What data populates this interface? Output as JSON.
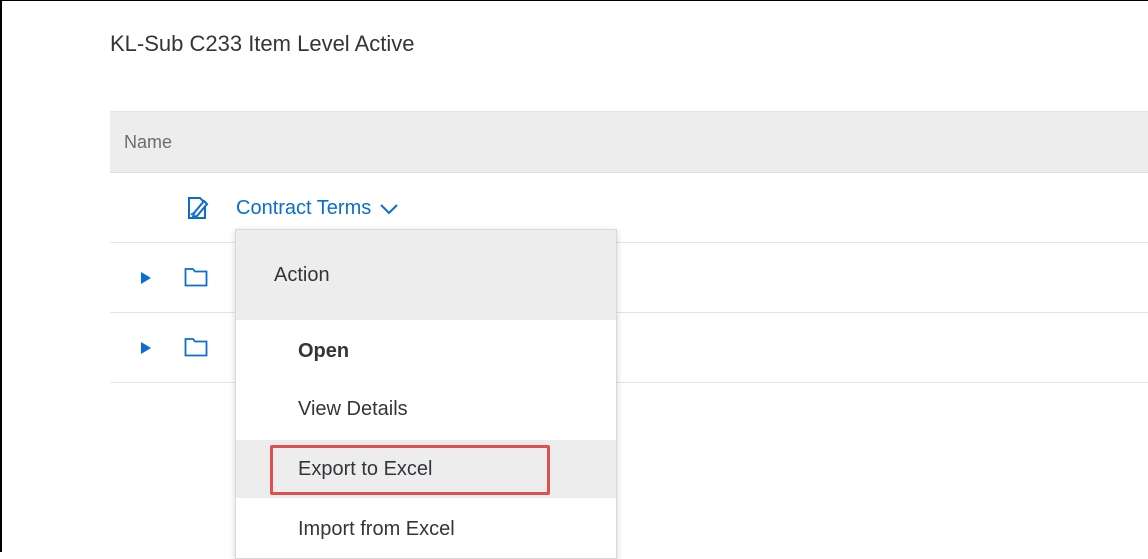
{
  "page": {
    "title": "KL-Sub C233 Item Level Active"
  },
  "table": {
    "column_name": "Name",
    "rows": [
      {
        "label": "Contract Terms",
        "icon": "contract-terms-icon",
        "dropdown_icon": "chevron-down-icon"
      },
      {
        "label": "",
        "icon": "folder-icon",
        "expand_icon": "expand-arrow-icon"
      },
      {
        "label": "",
        "icon": "folder-icon",
        "expand_icon": "expand-arrow-icon"
      }
    ]
  },
  "menu": {
    "header": "Action",
    "items": [
      {
        "label": "Open",
        "bold": true
      },
      {
        "label": "View Details"
      },
      {
        "label": "Export to Excel",
        "highlighted": true
      },
      {
        "label": "Import from Excel"
      }
    ]
  },
  "colors": {
    "link": "#0a6ed1",
    "header_bg": "#ededed",
    "text": "#32363a",
    "highlight_border": "#e05050"
  }
}
